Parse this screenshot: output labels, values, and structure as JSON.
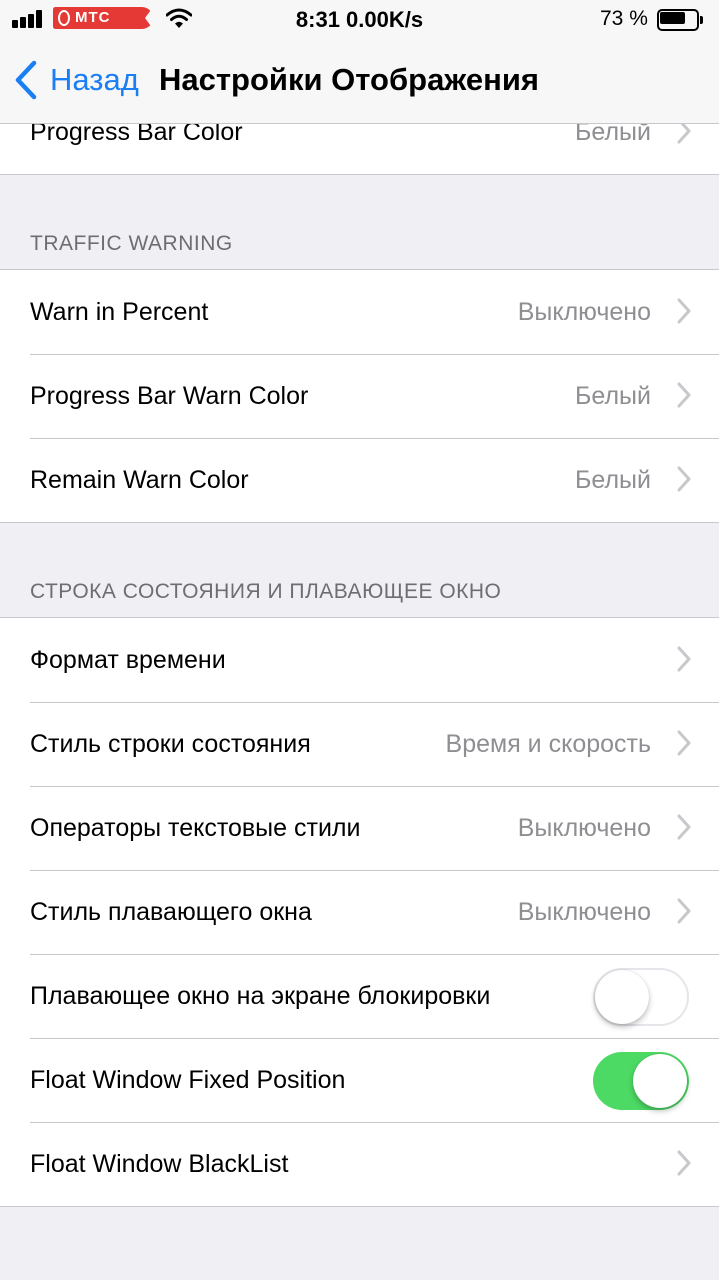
{
  "status_bar": {
    "carrier": "МТС",
    "time": "8:31 0.00K/s",
    "battery_percent": "73 %",
    "battery_level": 0.73,
    "signal_bars": 4
  },
  "nav": {
    "back_label": "Назад",
    "title": "Настройки Отображения"
  },
  "top_group": {
    "rows": [
      {
        "label": "Progress Bar Color",
        "value": "Белый"
      }
    ]
  },
  "traffic_warning": {
    "header": "TRAFFIC WARNING",
    "rows": [
      {
        "label": "Warn in Percent",
        "value": "Выключено"
      },
      {
        "label": "Progress Bar Warn Color",
        "value": "Белый"
      },
      {
        "label": "Remain Warn Color",
        "value": "Белый"
      }
    ]
  },
  "status_float": {
    "header": "СТРОКА СОСТОЯНИЯ И ПЛАВАЮЩЕЕ ОКНО",
    "rows": [
      {
        "label": "Формат времени",
        "value": ""
      },
      {
        "label": "Стиль строки состояния",
        "value": "Время и скорость"
      },
      {
        "label": "Операторы текстовые стили",
        "value": "Выключено"
      },
      {
        "label": "Стиль плавающего окна",
        "value": "Выключено"
      },
      {
        "label": "Плавающее окно на экране блокировки",
        "toggle": false
      },
      {
        "label": "Float Window Fixed Position",
        "toggle": true
      },
      {
        "label": "Float Window BlackList",
        "value": ""
      }
    ]
  },
  "colors": {
    "accent": "#1a7ef5",
    "toggle_on": "#4cd964",
    "carrier_red": "#e53935",
    "secondary_text": "#8e8e93",
    "background": "#efeff4"
  }
}
